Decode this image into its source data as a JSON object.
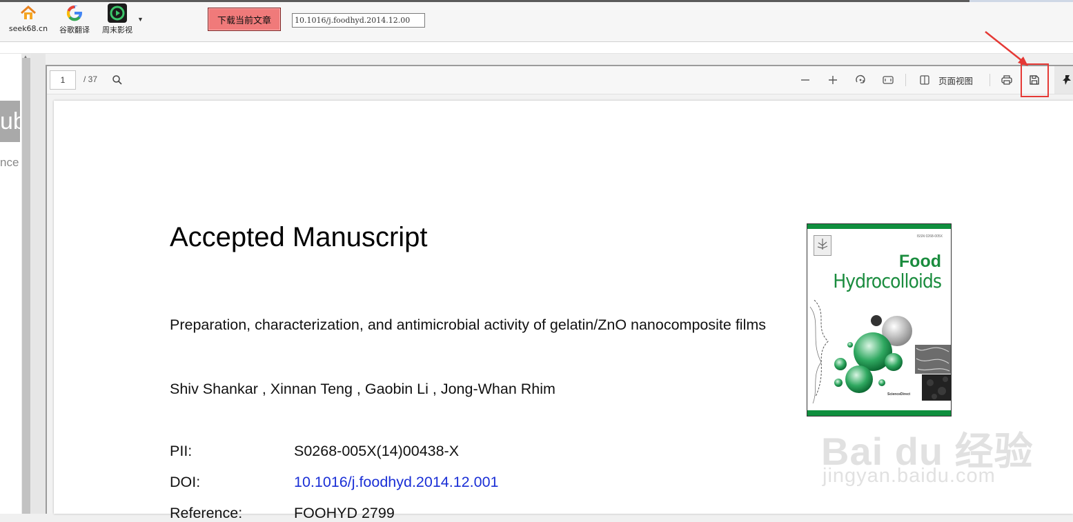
{
  "bookmarks": [
    {
      "label": "seek68.cn",
      "icon": "home-icon"
    },
    {
      "label": "谷歌翻译",
      "icon": "google-icon"
    },
    {
      "label": "周末影视",
      "icon": "play-icon"
    }
  ],
  "download_button": {
    "label": "下载当前文章"
  },
  "doi_input": {
    "value": "10.1016/j.foodhyd.2014.12.00"
  },
  "left_page": {
    "logo_text": "ub",
    "caption": "nce"
  },
  "viewer": {
    "page_current": "1",
    "page_total": "/ 37",
    "page_view_label": "页面视图",
    "icons": [
      "search-icon",
      "zoom-out-icon",
      "zoom-in-icon",
      "rotate-icon",
      "fit-page-icon",
      "page-view-icon",
      "print-icon",
      "save-icon",
      "pin-icon"
    ]
  },
  "document": {
    "title": "Accepted Manuscript",
    "article_title": "Preparation, characterization, and antimicrobial activity of gelatin/ZnO nanocomposite films",
    "authors": "Shiv Shankar , Xinnan Teng , Gaobin Li , Jong-Whan Rhim",
    "pii_label": "PII:",
    "pii_value": "S0268-005X(14)00438-X",
    "doi_label": "DOI:",
    "doi_value": "10.1016/j.foodhyd.2014.12.001",
    "reference_label": "Reference:",
    "reference_value": "FOOHYD 2799"
  },
  "cover": {
    "issn": "ISSN 0268-005X",
    "title_line1": "Food",
    "title_line2": "Hydrocolloids",
    "footer": "ScienceDirect",
    "accent_color": "#1a8c3e"
  },
  "watermark": {
    "line1": "Bai du 经验",
    "line2": "jingyan.baidu.com"
  },
  "colors": {
    "annotation_red": "#e53935",
    "download_button_bg": "#f07a7a",
    "link_blue": "#1a2fd6"
  }
}
